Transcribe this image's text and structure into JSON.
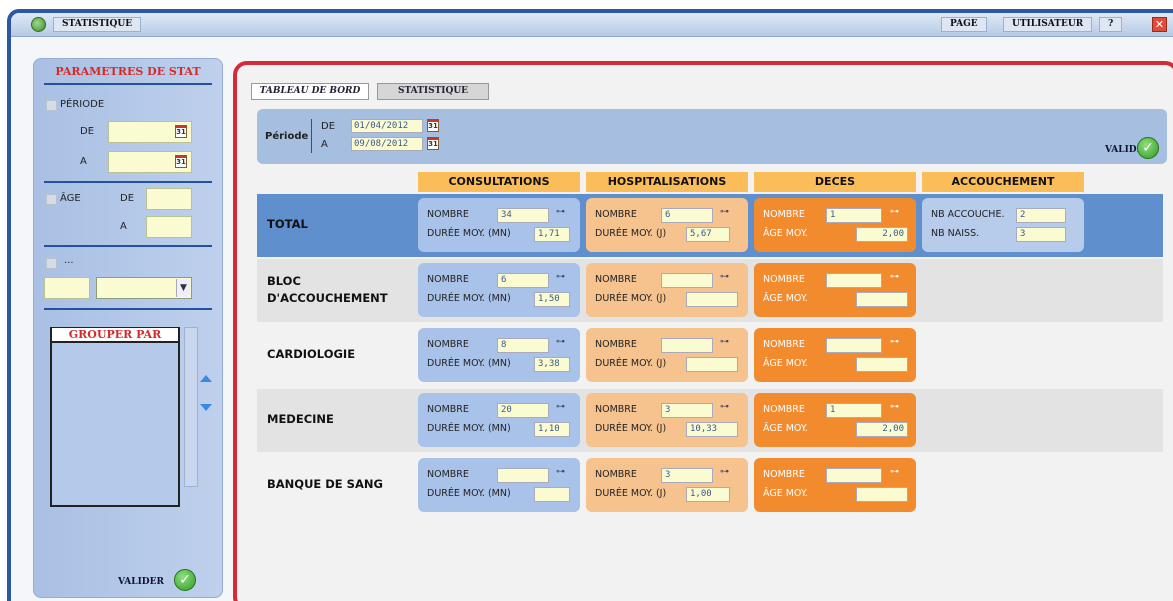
{
  "titlebar": {
    "title": "STATISTIQUE",
    "menu": [
      "PAGE",
      "UTILISATEUR",
      "?"
    ],
    "close": "✕"
  },
  "left_panel": {
    "title": "PARAMETRES DE STAT",
    "periode_label": "PÉRIODE",
    "de_label": "DE",
    "a_label": "A",
    "age_label": "ÂGE",
    "age_de_label": "DE",
    "age_a_label": "A",
    "extra_label": "...",
    "group_title": "GROUPER PAR",
    "valider_label": "VALIDER"
  },
  "main": {
    "tabs": [
      {
        "label": "TABLEAU DE BORD",
        "active": true
      },
      {
        "label": "STATISTIQUE",
        "active": false
      }
    ],
    "period": {
      "label": "Période",
      "de_label": "DE",
      "a_label": "A",
      "de_value": "01/04/2012",
      "a_value": "09/08/2012",
      "valider_label": "VALIDER"
    },
    "columns": [
      "CONSULTATIONS",
      "HOSPITALISATIONS",
      "DECES",
      "ACCOUCHEMENT"
    ],
    "labels": {
      "nombre": "NOMBRE",
      "duree_mn": "DURÉE MOY. (MN)",
      "duree_j": "DURÉE MOY. (J)",
      "age_moy": "ÂGE MOY.",
      "nb_accouche": "NB ACCOUCHE.",
      "nb_naiss": "NB NAISS."
    },
    "rows": [
      {
        "label": "TOTAL",
        "consult": {
          "nombre": "34",
          "duree": "1,71"
        },
        "hosp": {
          "nombre": "6",
          "duree": "5,67"
        },
        "deces": {
          "nombre": "1",
          "age": "2,00"
        },
        "accouch": {
          "nb_accouche": "2",
          "nb_naiss": "3"
        }
      },
      {
        "label": "BLOC D'ACCOUCHEMENT",
        "consult": {
          "nombre": "6",
          "duree": "1,50"
        },
        "hosp": {
          "nombre": "",
          "duree": ""
        },
        "deces": {
          "nombre": "",
          "age": ""
        }
      },
      {
        "label": "CARDIOLOGIE",
        "consult": {
          "nombre": "8",
          "duree": "3,38"
        },
        "hosp": {
          "nombre": "",
          "duree": ""
        },
        "deces": {
          "nombre": "",
          "age": ""
        }
      },
      {
        "label": "MEDECINE",
        "consult": {
          "nombre": "20",
          "duree": "1,10"
        },
        "hosp": {
          "nombre": "3",
          "duree": "10,33"
        },
        "deces": {
          "nombre": "1",
          "age": "2,00"
        }
      },
      {
        "label": "BANQUE DE SANG",
        "consult": {
          "nombre": "",
          "duree": ""
        },
        "hosp": {
          "nombre": "3",
          "duree": "1,00"
        },
        "deces": {
          "nombre": "",
          "age": ""
        }
      }
    ]
  },
  "colors": {
    "frame": "#2a58a6",
    "main_border": "#d42a3a",
    "col_header": "#fbbd5a",
    "consult": "#a9c2e9",
    "hosp": "#f6c28e",
    "deces": "#f28a2e"
  },
  "icons": [
    "app-icon",
    "calendar-icon",
    "eye-icon",
    "check-icon",
    "arrow-up-icon",
    "arrow-down-icon",
    "close-icon",
    "chevron-down-icon"
  ]
}
